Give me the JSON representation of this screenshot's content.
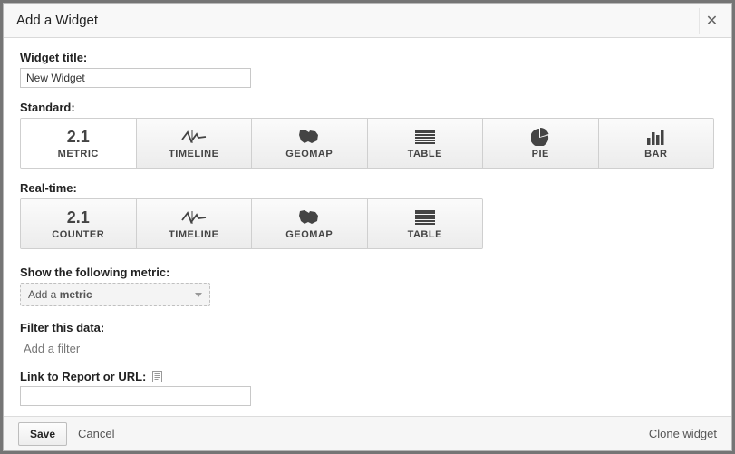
{
  "header": {
    "title": "Add a Widget"
  },
  "fields": {
    "widget_title_label": "Widget title:",
    "widget_title_value": "New Widget",
    "standard_label": "Standard:",
    "realtime_label": "Real-time:",
    "metric_label": "Show the following metric:",
    "metric_prefix": "Add a ",
    "metric_bold": "metric",
    "filter_label": "Filter this data:",
    "filter_add": "Add a filter",
    "link_label": "Link to Report or URL:"
  },
  "standard_types": [
    {
      "key": "metric",
      "label": "METRIC",
      "icon": "2.1",
      "selected": true
    },
    {
      "key": "timeline",
      "label": "TIMELINE",
      "icon": "timeline"
    },
    {
      "key": "geomap",
      "label": "GEOMAP",
      "icon": "geomap"
    },
    {
      "key": "table",
      "label": "TABLE",
      "icon": "table"
    },
    {
      "key": "pie",
      "label": "PIE",
      "icon": "pie"
    },
    {
      "key": "bar",
      "label": "BAR",
      "icon": "bar"
    }
  ],
  "realtime_types": [
    {
      "key": "counter",
      "label": "COUNTER",
      "icon": "2.1"
    },
    {
      "key": "timeline",
      "label": "TIMELINE",
      "icon": "timeline"
    },
    {
      "key": "geomap",
      "label": "GEOMAP",
      "icon": "geomap"
    },
    {
      "key": "table",
      "label": "TABLE",
      "icon": "table"
    }
  ],
  "footer": {
    "save": "Save",
    "cancel": "Cancel",
    "clone": "Clone widget"
  }
}
